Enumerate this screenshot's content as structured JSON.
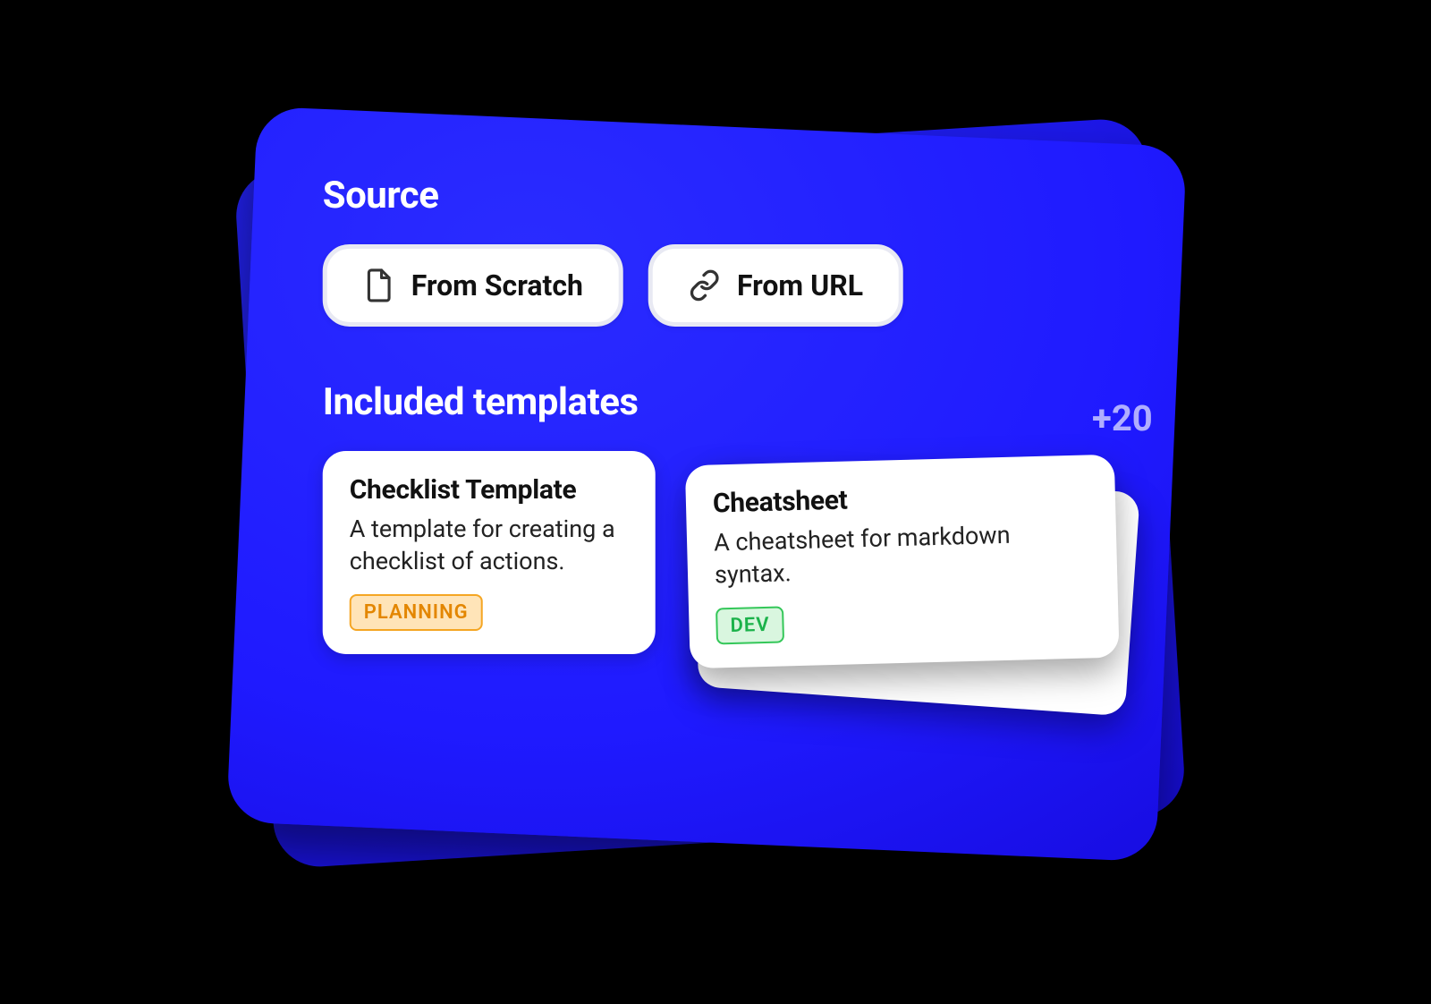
{
  "source": {
    "title": "Source",
    "buttons": [
      {
        "label": "From Scratch",
        "icon": "document-icon"
      },
      {
        "label": "From URL",
        "icon": "link-icon"
      }
    ]
  },
  "templates": {
    "title": "Included templates",
    "more_count": "+20",
    "cards": [
      {
        "title": "Checklist Template",
        "description": "A template for creating a checklist of actions.",
        "tag": "PLANNING",
        "tag_style": "planning"
      },
      {
        "title": "Cheatsheet",
        "description": "A cheatsheet for markdown syntax.",
        "tag": "DEV",
        "tag_style": "dev"
      }
    ]
  }
}
